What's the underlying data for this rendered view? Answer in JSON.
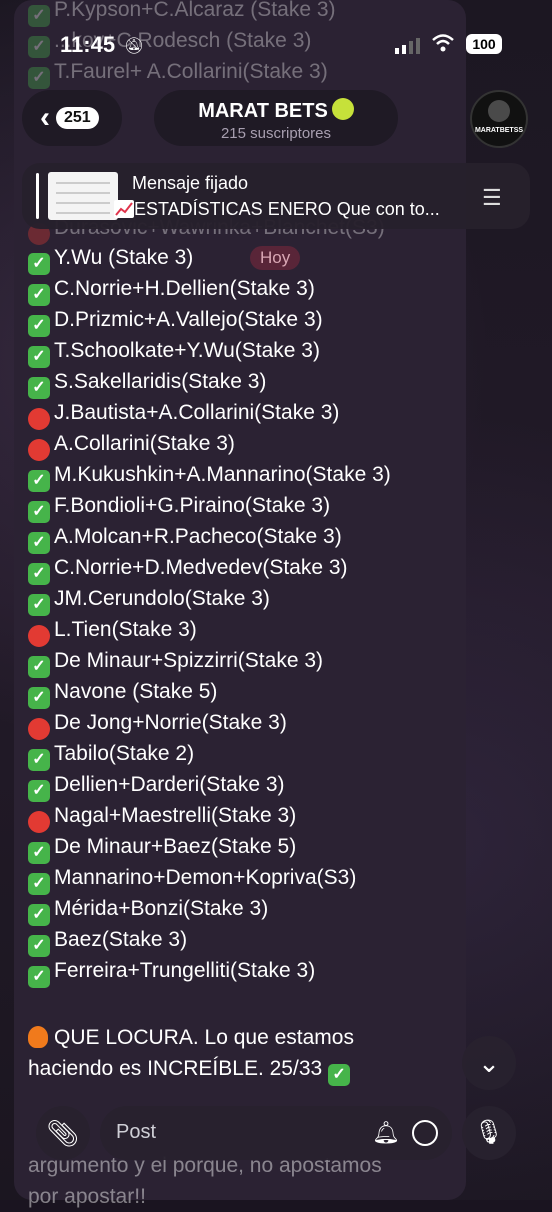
{
  "status": {
    "time": "11:45",
    "battery": "100"
  },
  "header": {
    "back_count": "251",
    "channel_name": "MARAT BETS",
    "subscribers": "215 suscriptores",
    "avatar_label": "MARATBETSS"
  },
  "pinned": {
    "label": "Mensaje fijado",
    "text": "ESTADÍSTICAS ENERO Que con to..."
  },
  "date_badge": "Hoy",
  "faded_top": [
    "P.Kypson+C.Alcaraz (Stake 3)",
    "...kov+C.Rodesch (Stake 3)",
    "T.Faurel+ A.Collarini(Stake 3)"
  ],
  "faded_partial": "Durasovic+Wawrinka+Blanchet(S3)",
  "picks": [
    {
      "result": "win",
      "text": "Y.Wu (Stake 3)"
    },
    {
      "result": "win",
      "text": "C.Norrie+H.Dellien(Stake 3)"
    },
    {
      "result": "win",
      "text": "D.Prizmic+A.Vallejo(Stake 3)"
    },
    {
      "result": "win",
      "text": "T.Schoolkate+Y.Wu(Stake 3)"
    },
    {
      "result": "win",
      "text": "S.Sakellaridis(Stake 3)"
    },
    {
      "result": "loss",
      "text": "J.Bautista+A.Collarini(Stake 3)"
    },
    {
      "result": "loss",
      "text": "A.Collarini(Stake 3)"
    },
    {
      "result": "win",
      "text": "M.Kukushkin+A.Mannarino(Stake 3)"
    },
    {
      "result": "win",
      "text": "F.Bondioli+G.Piraino(Stake 3)"
    },
    {
      "result": "win",
      "text": "A.Molcan+R.Pacheco(Stake 3)"
    },
    {
      "result": "win",
      "text": "C.Norrie+D.Medvedev(Stake 3)"
    },
    {
      "result": "win",
      "text": "JM.Cerundolo(Stake 3)"
    },
    {
      "result": "loss",
      "text": "L.Tien(Stake 3)"
    },
    {
      "result": "win",
      "text": "De Minaur+Spizzirri(Stake 3)"
    },
    {
      "result": "win",
      "text": "Navone (Stake 5)"
    },
    {
      "result": "loss",
      "text": "De Jong+Norrie(Stake 3)"
    },
    {
      "result": "win",
      "text": "Tabilo(Stake 2)"
    },
    {
      "result": "win",
      "text": "Dellien+Darderi(Stake 3)"
    },
    {
      "result": "loss",
      "text": "Nagal+Maestrelli(Stake 3)"
    },
    {
      "result": "win",
      "text": "De Minaur+Baez(Stake 5)"
    },
    {
      "result": "win",
      "text": "Mannarino+Demon+Kopriva(S3)"
    },
    {
      "result": "win",
      "text": "Mérida+Bonzi(Stake 3)"
    },
    {
      "result": "win",
      "text": "Baez(Stake 3)"
    },
    {
      "result": "win",
      "text": "Ferreira+Trungelliti(Stake 3)"
    }
  ],
  "summary_line1": "QUE LOCURA. Lo que estamos",
  "summary_line2": "haciendo es INCREÍBLE. 25/33",
  "tail_line1": "argumento y el porque, no apostamos",
  "tail_line2": "por apostar!!",
  "composer": {
    "placeholder": "Post"
  }
}
